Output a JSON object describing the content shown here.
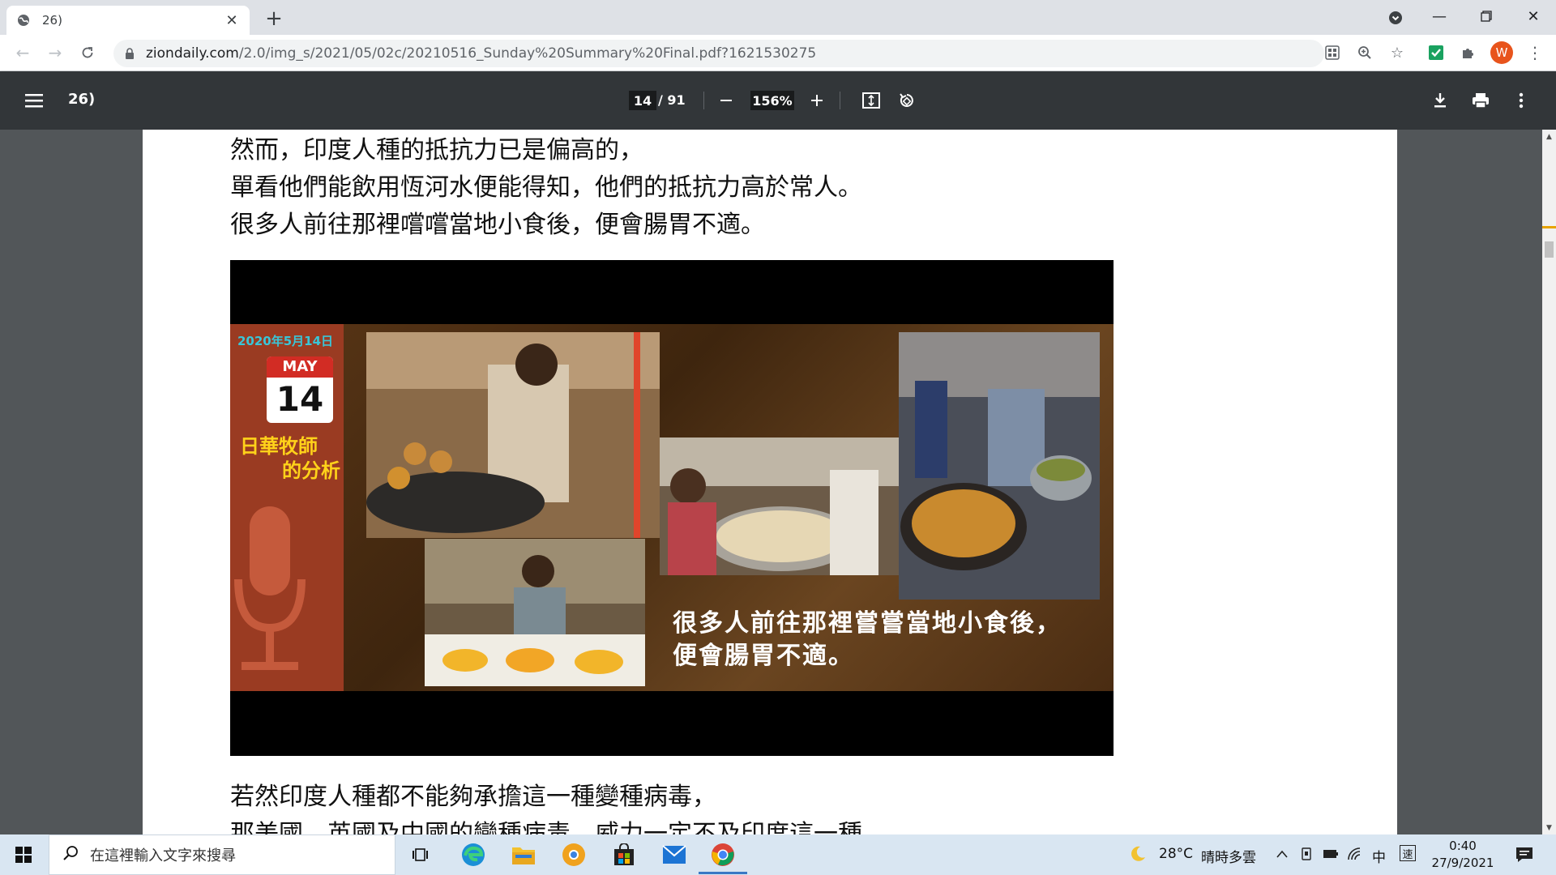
{
  "browser": {
    "tab_title": "26)",
    "url_host": "ziondaily.com",
    "url_path": "/2.0/img_s/2021/05/02c/20210516_Sunday%20Summary%20Final.pdf?1621530275",
    "profile_initial": "W"
  },
  "pdf": {
    "title": "26)",
    "current_page": "14",
    "total_pages": "/ 91",
    "zoom": "156%"
  },
  "page": {
    "lines_top": [
      "然而，印度人種的抵抗力已是偏高的，",
      "單看他們能飲用恆河水便能得知，他們的抵抗力高於常人。",
      "很多人前往那裡嚐嚐當地小食後，便會腸胃不適。"
    ],
    "lines_bottom": [
      "若然印度人種都不能夠承擔這一種變種病毒，",
      "那美國、英國及中國的變種病毒，威力一定不及印度這一種。"
    ]
  },
  "figure": {
    "date_label": "2020年5月14日",
    "cal_month": "MAY",
    "cal_day": "14",
    "heading_line1": "日華牧師",
    "heading_line2": "的分析",
    "caption_line1": "很多人前往那裡嘗嘗當地小食後，",
    "caption_line2": "便會腸胃不適。"
  },
  "taskbar": {
    "search_placeholder": "在這裡輸入文字來搜尋",
    "weather_temp": "28°C",
    "weather_desc": "晴時多雲",
    "ime": "中",
    "ime2": "速",
    "time": "0:40",
    "date": "27/9/2021"
  },
  "colors": {
    "pdf_toolbar": "#323639",
    "viewer_bg": "#525659",
    "banner_side": "#9a3b22",
    "heading_yellow": "#ffd21a",
    "date_cyan": "#39c6d8"
  }
}
